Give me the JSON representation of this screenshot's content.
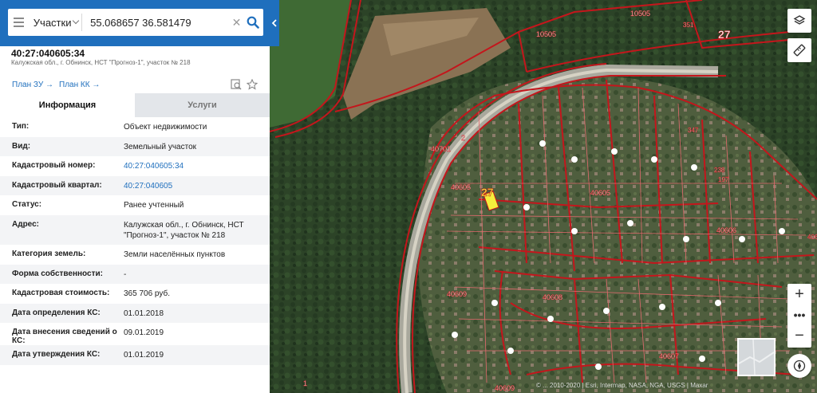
{
  "search": {
    "mode": "Участки",
    "query": "55.068657 36.581479",
    "clear_glyph": "✕"
  },
  "object": {
    "title": "40:27:040605:34",
    "subtitle": "Калужская обл., г. Обнинск, НСТ \"Прогноз-1\", участок № 218",
    "plan_zu": "План ЗУ →",
    "plan_kk": "План КК →"
  },
  "tabs": [
    {
      "label": "Информация"
    },
    {
      "label": "Услуги"
    }
  ],
  "info_rows": [
    {
      "key": "Тип:",
      "value": "Объект недвижимости"
    },
    {
      "key": "Вид:",
      "value": "Земельный участок"
    },
    {
      "key": "Кадастровый номер:",
      "value": "40:27:040605:34"
    },
    {
      "key": "Кадастровый квартал:",
      "value": "40:27:040605"
    },
    {
      "key": "Статус:",
      "value": "Ранее учтенный"
    },
    {
      "key": "Адрес:",
      "value": "Калужская обл., г. Обнинск, НСТ \"Прогноз-1\", участок № 218"
    },
    {
      "key": "Категория земель:",
      "value": "Земли населённых пунктов"
    },
    {
      "key": "Форма собственности:",
      "value": "-"
    },
    {
      "key": "Кадастровая стоимость:",
      "value": "365 706 руб."
    },
    {
      "key": "Дата определения КС:",
      "value": "01.01.2018"
    },
    {
      "key": "Дата внесения сведений о КС:",
      "value": "09.01.2019"
    },
    {
      "key": "Дата утверждения КС:",
      "value": "01.01.2019"
    }
  ],
  "map_labels": {
    "l10505a": "10505",
    "l10505b": "10505",
    "l27a": "27",
    "l27b": "27",
    "l351": "351",
    "l40701": "40701",
    "l40605a": "40605",
    "l40605b": "40605",
    "l40606": "40606",
    "l40609a": "40609",
    "l40609b": "40609",
    "l40608": "40608",
    "l40607": "40607",
    "l40603": "40603",
    "l1": "1",
    "l2": "2",
    "l347": "347",
    "l238": "238",
    "l197": "197"
  },
  "attribution": "© ... 2010-2020 | Esri, Intermap, NASA, NGA, USGS | Maxar",
  "controls": {
    "zoom_in": "+",
    "zoom_more": "•••",
    "zoom_out": "−"
  },
  "colors": {
    "brand_blue": "#1f6fbd",
    "parcel_red": "#c4161c",
    "selected_parcel": "#f5ee3c"
  }
}
